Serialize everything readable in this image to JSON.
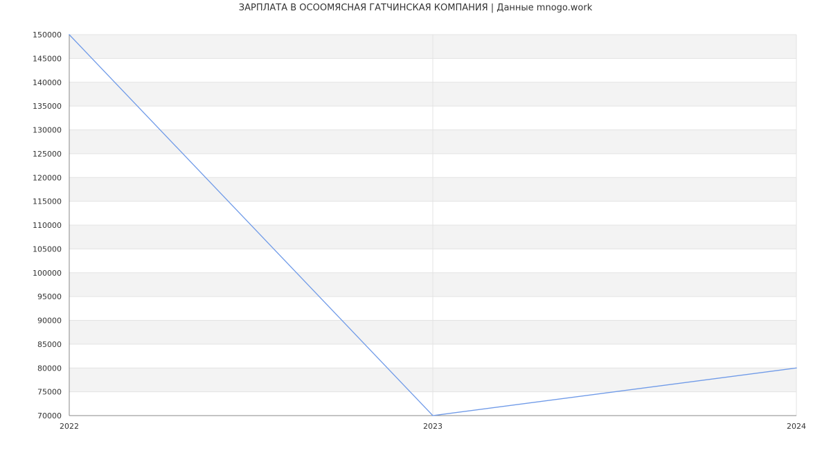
{
  "chart_data": {
    "type": "line",
    "title": "ЗАРПЛАТА В ОСООМЯСНАЯ ГАТЧИНСКАЯ КОМПАНИЯ | Данные mnogo.work",
    "xlabel": "",
    "ylabel": "",
    "x": [
      "2022",
      "2023",
      "2024"
    ],
    "series": [
      {
        "values": [
          150000,
          70000,
          80000
        ]
      }
    ],
    "ylim": [
      70000,
      150000
    ],
    "y_ticks": [
      70000,
      75000,
      80000,
      85000,
      90000,
      95000,
      100000,
      105000,
      110000,
      115000,
      120000,
      125000,
      130000,
      135000,
      140000,
      145000,
      150000
    ],
    "grid": true,
    "colors": {
      "line": "#6f9ae8",
      "band": "#f3f3f3",
      "grid": "#e3e3e3",
      "axis": "#888888"
    }
  }
}
